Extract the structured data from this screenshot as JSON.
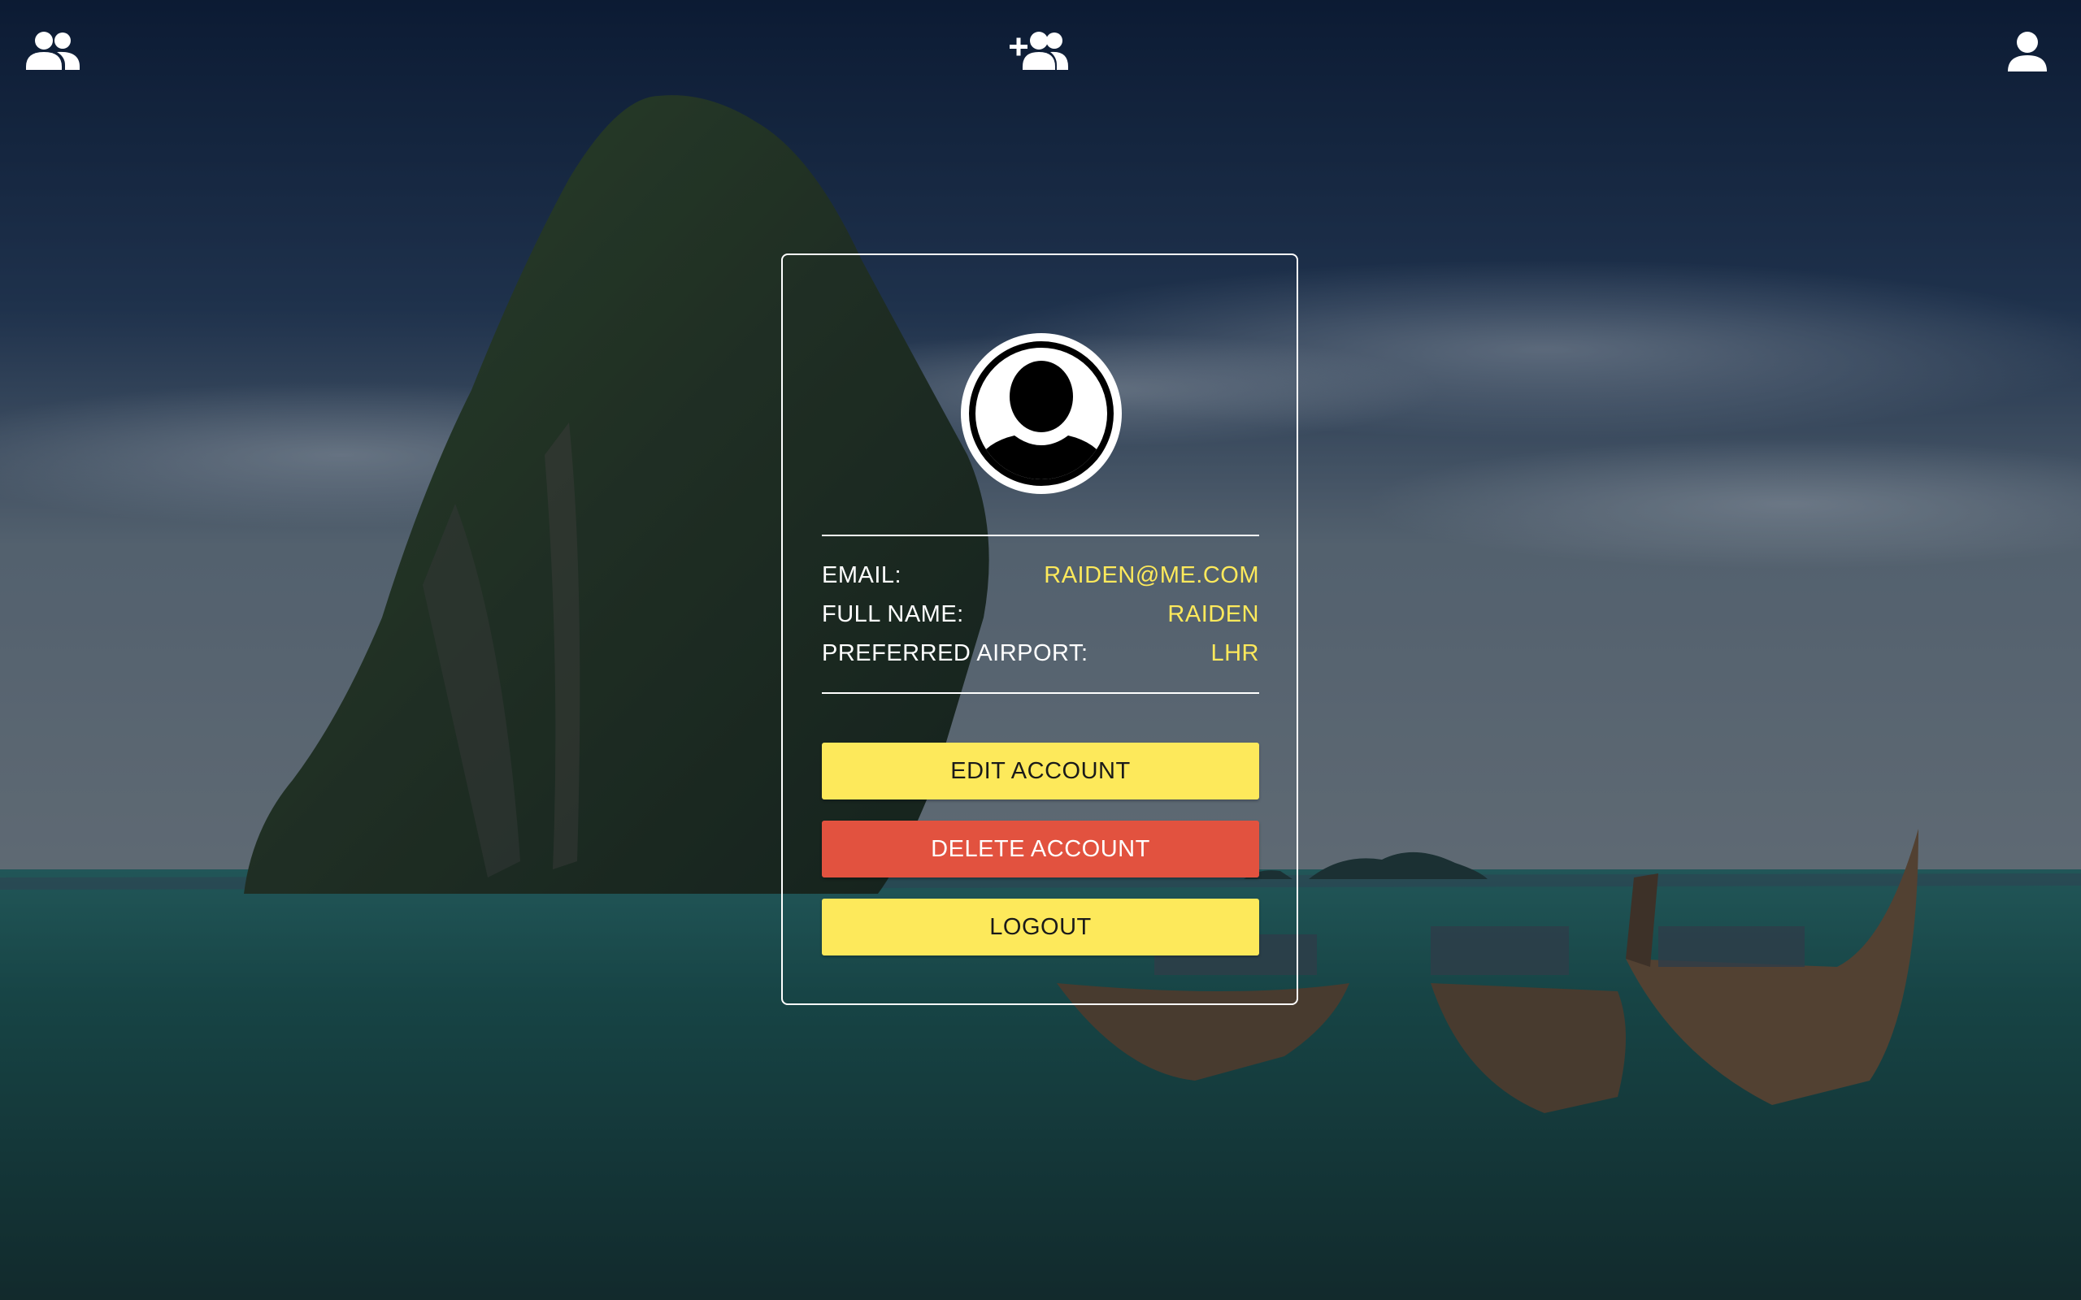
{
  "nav": {
    "friends_icon": "friends-icon",
    "add_friend_icon": "add-friend-icon",
    "profile_icon": "profile-icon"
  },
  "profile": {
    "avatar_icon": "avatar-placeholder-icon",
    "fields": [
      {
        "label": "EMAIL:",
        "value": "RAIDEN@ME.COM"
      },
      {
        "label": "FULL NAME:",
        "value": "RAIDEN"
      },
      {
        "label": "PREFERRED AIRPORT:",
        "value": "LHR"
      }
    ]
  },
  "actions": {
    "edit_label": "EDIT ACCOUNT",
    "delete_label": "DELETE ACCOUNT",
    "logout_label": "LOGOUT"
  },
  "colors": {
    "accent_yellow": "#fde95b",
    "danger_red": "#e2523f",
    "text_white": "#ffffff"
  }
}
